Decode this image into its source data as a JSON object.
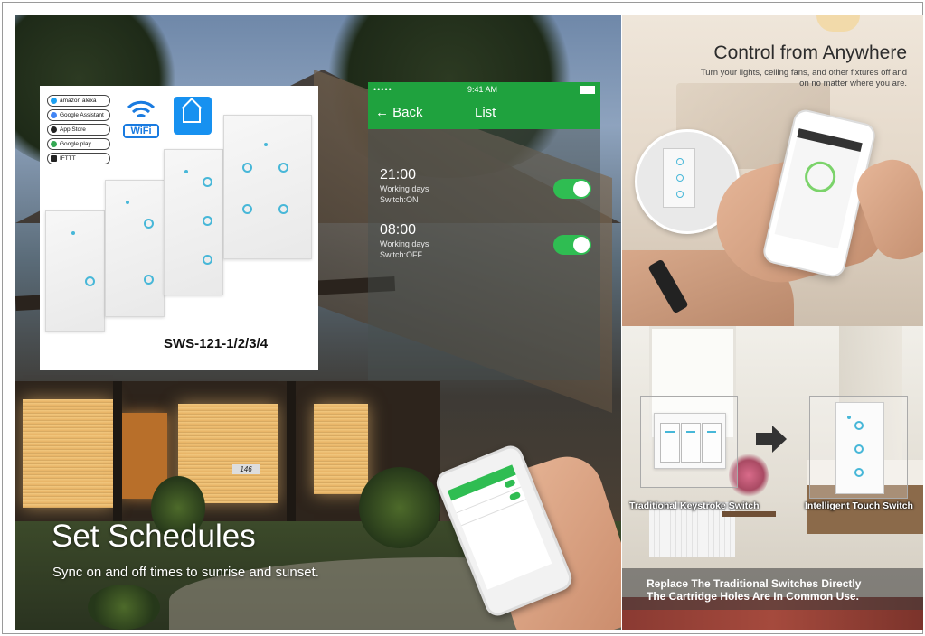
{
  "product": {
    "badges": [
      "amazon alexa",
      "Google Assistant",
      "App Store",
      "Google play",
      "IFTTT"
    ],
    "wifi_label": "WiFi",
    "model": "SWS-121-1/2/3/4"
  },
  "app_screen": {
    "status_dots": "•••••",
    "time": "9:41 AM",
    "back_label": "Back",
    "back_arrow": "←",
    "title": "List",
    "schedules": [
      {
        "time": "21:00",
        "days": "Working days",
        "action": "Switch:ON"
      },
      {
        "time": "08:00",
        "days": "Working days",
        "action": "Switch:OFF"
      }
    ]
  },
  "left_panel": {
    "title": "Set Schedules",
    "subtitle": "Sync on and off times to sunrise and sunset.",
    "house_number": "146"
  },
  "right_top": {
    "title": "Control from Anywhere",
    "subtitle_line1": "Turn your lights, ceiling fans, and other fixtures off and",
    "subtitle_line2": "on no matter where you are."
  },
  "right_bottom": {
    "label_old": "Traditional Keystroke Switch",
    "label_new": "Intelligent Touch Switch",
    "caption_line1": "Replace The Traditional Switches Directly",
    "caption_line2": "The Cartridge Holes Are In Common Use."
  },
  "colors": {
    "app_green": "#1fa23e",
    "toggle_green": "#2fbd52",
    "touch_blue": "#47b7d8",
    "wifi_blue": "#1a7be0"
  }
}
